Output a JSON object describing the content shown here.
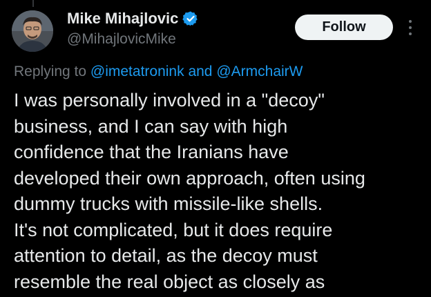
{
  "author": {
    "display_name": "Mike Mihajlovic",
    "handle": "@MihajlovicMike",
    "verified": true,
    "verified_color": "#1d9bf0"
  },
  "actions": {
    "follow_label": "Follow",
    "more_icon": "more-vertical-icon"
  },
  "reply_context": {
    "prefix": "Replying to",
    "mention_1": "@imetatronink",
    "conjunction": "and",
    "mention_2": "@ArmchairW"
  },
  "tweet": {
    "lines": [
      "I was personally involved in a \"decoy\"",
      "business, and I can say with high",
      "confidence that the Iranians have",
      "developed their own approach, often using",
      "dummy trucks with missile-like shells.",
      "It's not complicated, but it does require",
      "attention to detail, as the decoy must",
      "resemble the real object as closely as"
    ]
  },
  "colors": {
    "background": "#000000",
    "text": "#e7e9ea",
    "secondary": "#71767b",
    "link": "#1d9bf0",
    "follow_bg": "#eff3f4"
  }
}
